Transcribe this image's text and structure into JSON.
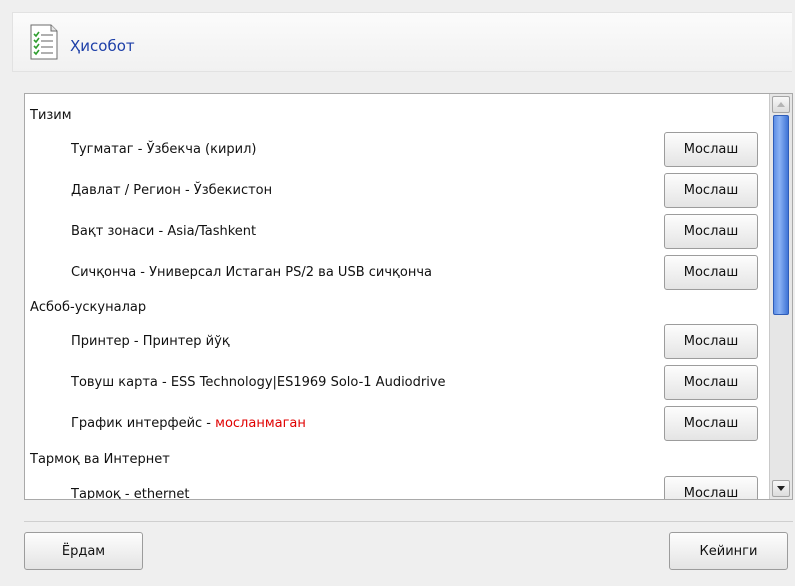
{
  "header": {
    "title": "Ҳисобот",
    "icon": "report-checklist-icon"
  },
  "sections": [
    {
      "title": "Тизим",
      "items": [
        {
          "label": "Тугматаг - Ўзбекча (кирил)",
          "status": "",
          "button": "Мослаш"
        },
        {
          "label": "Давлат / Регион - Ўзбекистон",
          "status": "",
          "button": "Мослаш"
        },
        {
          "label": "Вақт зонаси - Asia/Tashkent",
          "status": "",
          "button": "Мослаш"
        },
        {
          "label": "Сичқонча - Универсал Истаган PS/2 ва USB сичқонча",
          "status": "",
          "button": "Мослаш"
        }
      ]
    },
    {
      "title": "Асбоб-ускуналар",
      "items": [
        {
          "label": "Принтер - Принтер йўқ",
          "status": "",
          "button": "Мослаш"
        },
        {
          "label": "Товуш карта - ESS Technology|ES1969 Solo-1 Audiodrive",
          "status": "",
          "button": "Мослаш"
        },
        {
          "label": "График интерфейс - ",
          "status": "мосланмаган",
          "button": "Мослаш"
        }
      ]
    },
    {
      "title": "Тармоқ ва Интернет",
      "items": [
        {
          "label": "Тармоқ - ethernet",
          "status": "",
          "button": "Мослаш"
        }
      ]
    }
  ],
  "colors": {
    "title": "#1d3fa8",
    "status_bad": "#e00000",
    "scroll_thumb": "#5e8fe6"
  },
  "footer": {
    "help_label": "Ёрдам",
    "next_label": "Кейинги"
  }
}
